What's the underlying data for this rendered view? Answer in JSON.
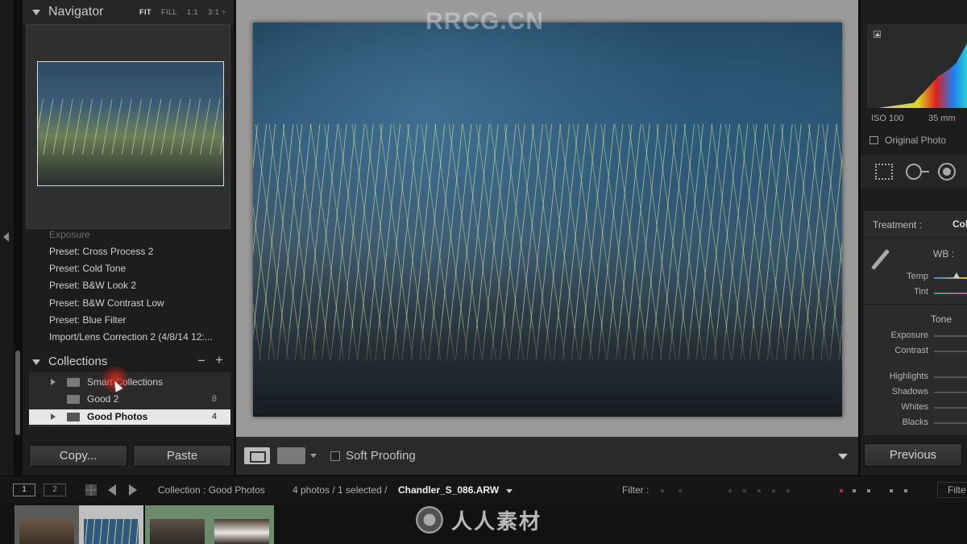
{
  "watermark": {
    "top": "RRCG.CN",
    "bottom": "人人素材"
  },
  "navigator": {
    "title": "Navigator",
    "zoom_options": [
      "FIT",
      "FILL",
      "1:1",
      "3:1 ÷"
    ],
    "active_zoom": "FIT"
  },
  "history": {
    "items": [
      "Preset: Cross Process 2",
      "Preset: Cold Tone",
      "Preset: B&W Look 2",
      "Preset: B&W Contrast Low",
      "Preset: Blue Filter",
      "Import/Lens Correction 2 (4/8/14 12:..."
    ],
    "faded_item": "Exposure"
  },
  "collections": {
    "title": "Collections",
    "minus": "−",
    "plus": "+",
    "rows": [
      {
        "label": "Smart Collections",
        "count": "",
        "expandable": true,
        "selected": false
      },
      {
        "label": "Good 2",
        "count": "8",
        "expandable": false,
        "selected": false
      },
      {
        "label": "Good Photos",
        "count": "4",
        "expandable": true,
        "selected": true
      }
    ]
  },
  "left_buttons": {
    "copy": "Copy...",
    "paste": "Paste"
  },
  "toolbar": {
    "soft_proofing": "Soft Proofing"
  },
  "right_panel": {
    "iso": "ISO 100",
    "focal_length": "35 mm",
    "original_photo": "Original Photo",
    "treatment_label": "Treatment :",
    "treatment_value": "Col",
    "wb_label": "WB :",
    "sliders_wb": [
      {
        "label": "Temp",
        "position": 0.78
      },
      {
        "label": "Tint",
        "position": 0.5
      }
    ],
    "tone_label": "Tone",
    "sliders_tone": [
      {
        "label": "Exposure"
      },
      {
        "label": "Contrast"
      },
      {
        "label": "Highlights"
      },
      {
        "label": "Shadows"
      },
      {
        "label": "Whites"
      },
      {
        "label": "Blacks"
      }
    ],
    "previous_button": "Previous"
  },
  "filmstrip_bar": {
    "screen1": "1",
    "screen2": "2",
    "source": "Collection : Good Photos",
    "count": "4 photos / 1 selected /",
    "filename": "Chandler_S_086.ARW",
    "filter_label": "Filter :",
    "filters_btn": "Filte"
  },
  "filmstrip": {
    "thumbnails": 4,
    "selected_index": 1
  }
}
